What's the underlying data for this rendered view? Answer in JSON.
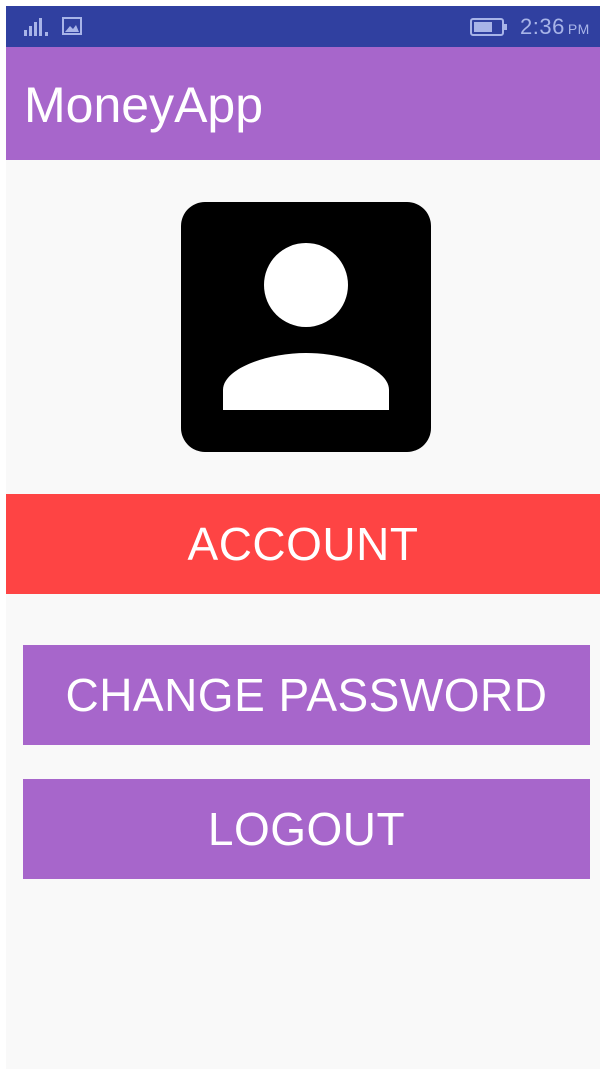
{
  "status_bar": {
    "time": "2:36",
    "ampm": "PM",
    "icons": [
      "signal-icon",
      "gallery-icon",
      "battery-icon"
    ]
  },
  "app_bar": {
    "title": "MoneyApp"
  },
  "profile": {
    "avatar_icon": "account-box-icon",
    "section_label": "ACCOUNT"
  },
  "actions": {
    "change_password": "CHANGE PASSWORD",
    "logout": "LOGOUT"
  },
  "colors": {
    "status_bar": "#3040a0",
    "primary": "#a766cb",
    "accent": "#fe4444",
    "background": "#f9f9f9"
  }
}
